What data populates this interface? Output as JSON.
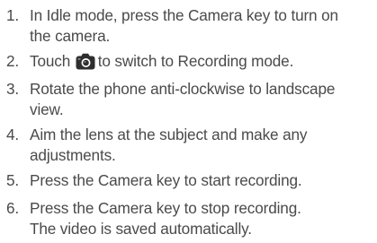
{
  "steps": [
    {
      "number": "1.",
      "lines": [
        "In Idle mode, press the Camera key to turn on",
        "the camera."
      ]
    },
    {
      "number": "2.",
      "before_icon": "Touch",
      "icon": "camera-icon",
      "after_icon": "to switch to Recording mode."
    },
    {
      "number": "3.",
      "lines": [
        "Rotate the phone anti-clockwise to landscape",
        "view."
      ]
    },
    {
      "number": "4.",
      "lines": [
        "Aim the lens at the subject and make any",
        "adjustments."
      ]
    },
    {
      "number": "5.",
      "lines": [
        "Press the Camera key to start recording."
      ]
    },
    {
      "number": "6.",
      "lines": [
        "Press the Camera key to stop recording.",
        "The video is saved automatically."
      ]
    }
  ]
}
